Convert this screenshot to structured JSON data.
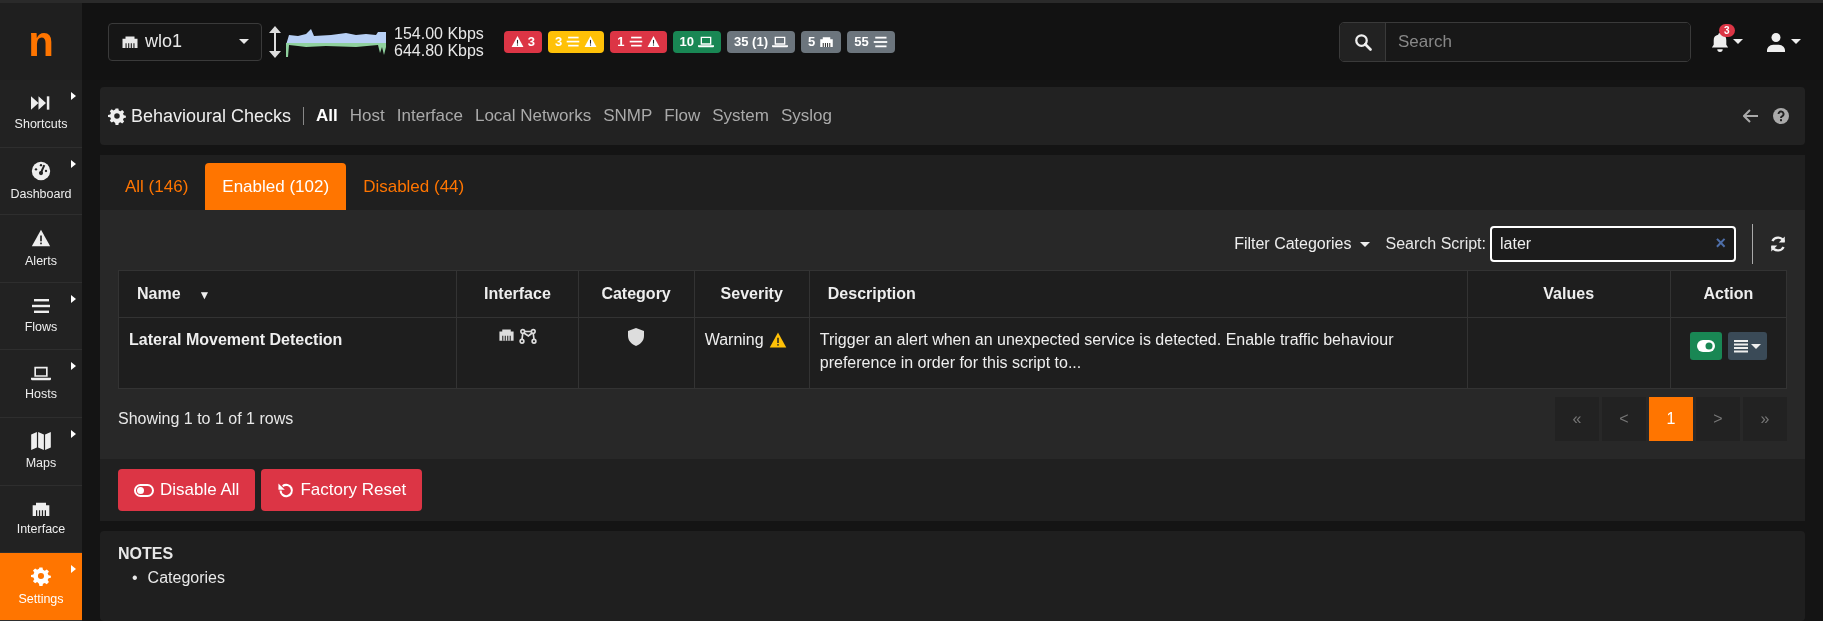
{
  "logo": {
    "text": "n"
  },
  "interface_selector": {
    "value": "wlo1"
  },
  "throughput": {
    "upload": "154.00 Kbps",
    "download": "644.80 Kbps"
  },
  "badges": [
    {
      "kind": "alerts",
      "text": "3",
      "color": "#dc3545"
    },
    {
      "kind": "flow-alerts",
      "text": "3",
      "color": "#ffc107"
    },
    {
      "kind": "flow-alerts",
      "text": "1",
      "color": "#dc3545"
    },
    {
      "kind": "hosts",
      "text": "10",
      "color": "#198754"
    },
    {
      "kind": "hosts",
      "text": "35 (1)",
      "color": "#6c757d"
    },
    {
      "kind": "interfaces",
      "text": "5",
      "color": "#6c757d"
    },
    {
      "kind": "flows",
      "text": "55",
      "color": "#6c757d"
    }
  ],
  "search": {
    "placeholder": "Search"
  },
  "notifications": {
    "count": "3"
  },
  "sidebar": {
    "items": [
      {
        "label": "Shortcuts",
        "kind": "shortcuts",
        "submenu": true,
        "selected": false
      },
      {
        "label": "Dashboard",
        "kind": "dashboard",
        "submenu": true,
        "selected": false
      },
      {
        "label": "Alerts",
        "kind": "alerts",
        "submenu": false,
        "selected": false
      },
      {
        "label": "Flows",
        "kind": "flows",
        "submenu": true,
        "selected": false
      },
      {
        "label": "Hosts",
        "kind": "hosts",
        "submenu": true,
        "selected": false
      },
      {
        "label": "Maps",
        "kind": "maps",
        "submenu": true,
        "selected": false
      },
      {
        "label": "Interface",
        "kind": "interface",
        "submenu": false,
        "selected": false
      },
      {
        "label": "Settings",
        "kind": "settings",
        "submenu": true,
        "selected": true
      }
    ]
  },
  "page_header": {
    "title": "Behavioural Checks",
    "subsections": [
      {
        "label": "All",
        "selected": true
      },
      {
        "label": "Host",
        "selected": false
      },
      {
        "label": "Interface",
        "selected": false
      },
      {
        "label": "Local Networks",
        "selected": false
      },
      {
        "label": "SNMP",
        "selected": false
      },
      {
        "label": "Flow",
        "selected": false
      },
      {
        "label": "System",
        "selected": false
      },
      {
        "label": "Syslog",
        "selected": false
      }
    ]
  },
  "tabs": [
    {
      "label": "All (146)",
      "selected": false
    },
    {
      "label": "Enabled (102)",
      "selected": true
    },
    {
      "label": "Disabled (44)",
      "selected": false
    }
  ],
  "filter": {
    "label": "Filter Categories"
  },
  "search_script": {
    "label": "Search Script:",
    "value": "later",
    "clear": "×"
  },
  "table": {
    "columns": [
      {
        "label": "Name",
        "sort_indicator": "▼"
      },
      {
        "label": "Interface"
      },
      {
        "label": "Category"
      },
      {
        "label": "Severity"
      },
      {
        "label": "Description"
      },
      {
        "label": "Values"
      },
      {
        "label": "Action"
      }
    ],
    "rows": [
      {
        "name": "Lateral Movement Detection",
        "severity": "Warning",
        "description": "Trigger an alert when an unexpected service is detected. Enable traffic behaviour preference in order for this script to...",
        "enabled": true
      }
    ]
  },
  "summary": "Showing 1 to 1 of 1 rows",
  "pagination": [
    {
      "label": "«",
      "selected": false
    },
    {
      "label": "<",
      "selected": false
    },
    {
      "label": "1",
      "selected": true
    },
    {
      "label": ">",
      "selected": false
    },
    {
      "label": "»",
      "selected": false
    }
  ],
  "buttons": [
    {
      "kind": "disable",
      "label": "Disable All"
    },
    {
      "kind": "reset",
      "label": "Factory Reset"
    }
  ],
  "notes": {
    "title": "NOTES",
    "items": [
      {
        "marker": "•",
        "text": "Categories"
      }
    ]
  }
}
